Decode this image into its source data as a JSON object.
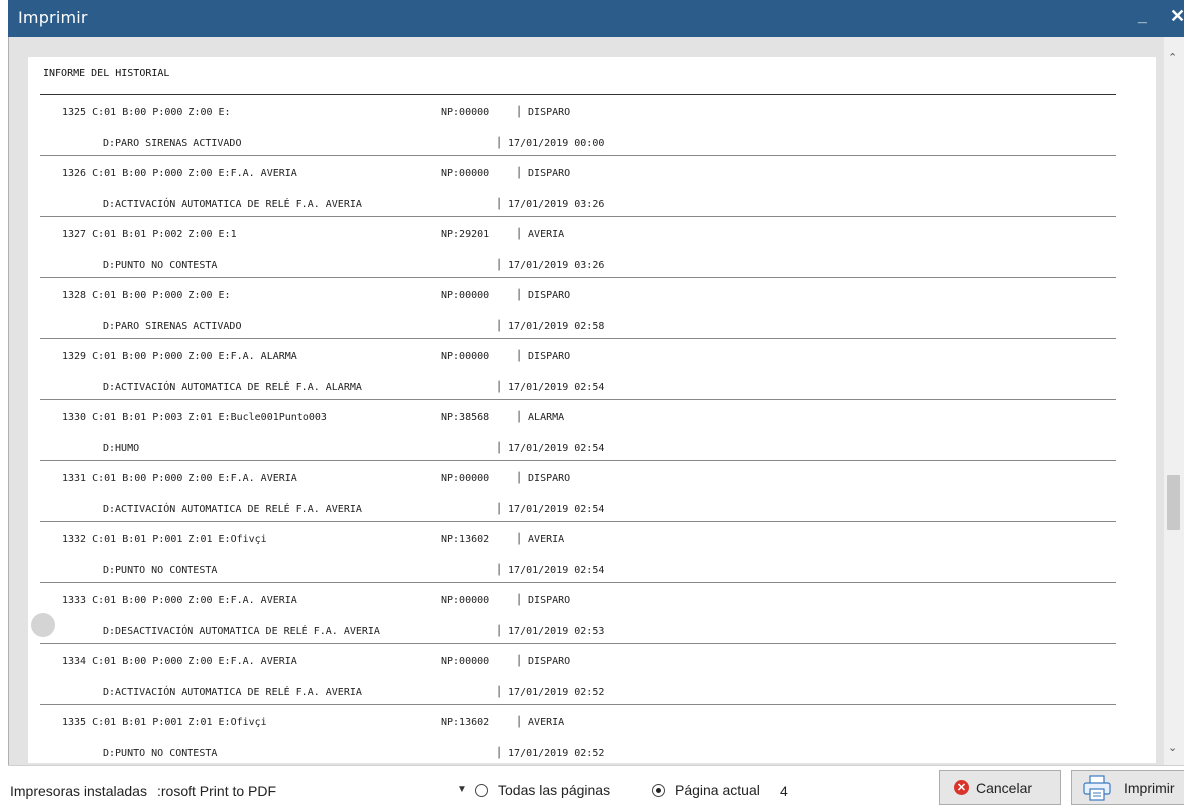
{
  "window": {
    "title": "Imprimir",
    "minimize_label": "_",
    "close_label": "✕"
  },
  "report": {
    "heading": "INFORME DEL HISTORIAL",
    "records": [
      {
        "id": "1325 C:01 B:00 P:000 Z:00 E:",
        "np": "NP:00000",
        "type": "│ DISPARO",
        "desc": "D:PARO SIRENAS ACTIVADO",
        "date": "│ 17/01/2019 00:00"
      },
      {
        "id": "1326 C:01 B:00 P:000 Z:00 E:F.A. AVERIA",
        "np": "NP:00000",
        "type": "│ DISPARO",
        "desc": "D:ACTIVACIÓN AUTOMATICA DE RELÉ F.A. AVERIA",
        "date": "│ 17/01/2019 03:26"
      },
      {
        "id": "1327 C:01 B:01 P:002 Z:00 E:1",
        "np": "NP:29201",
        "type": "│ AVERIA",
        "desc": "D:PUNTO NO CONTESTA",
        "date": "│ 17/01/2019 03:26"
      },
      {
        "id": "1328 C:01 B:00 P:000 Z:00 E:",
        "np": "NP:00000",
        "type": "│ DISPARO",
        "desc": "D:PARO SIRENAS ACTIVADO",
        "date": "│ 17/01/2019 02:58"
      },
      {
        "id": "1329 C:01 B:00 P:000 Z:00 E:F.A. ALARMA",
        "np": "NP:00000",
        "type": "│ DISPARO",
        "desc": "D:ACTIVACIÓN AUTOMATICA DE RELÉ F.A. ALARMA",
        "date": "│ 17/01/2019 02:54"
      },
      {
        "id": "1330 C:01 B:01 P:003 Z:01 E:Bucle001Punto003",
        "np": "NP:38568",
        "type": "│ ALARMA",
        "desc": "D:HUMO",
        "date": "│ 17/01/2019 02:54"
      },
      {
        "id": "1331 C:01 B:00 P:000 Z:00 E:F.A. AVERIA",
        "np": "NP:00000",
        "type": "│ DISPARO",
        "desc": "D:ACTIVACIÓN AUTOMATICA DE RELÉ F.A. AVERIA",
        "date": "│ 17/01/2019 02:54"
      },
      {
        "id": "1332 C:01 B:01 P:001 Z:01 E:Ofivçi",
        "np": "NP:13602",
        "type": "│ AVERIA",
        "desc": "D:PUNTO NO CONTESTA",
        "date": "│ 17/01/2019 02:54"
      },
      {
        "id": "1333 C:01 B:00 P:000 Z:00 E:F.A. AVERIA",
        "np": "NP:00000",
        "type": "│ DISPARO",
        "desc": "D:DESACTIVACIÓN AUTOMATICA DE RELÉ F.A. AVERIA",
        "date": "│ 17/01/2019 02:53"
      },
      {
        "id": "1334 C:01 B:00 P:000 Z:00 E:F.A. AVERIA",
        "np": "NP:00000",
        "type": "│ DISPARO",
        "desc": "D:ACTIVACIÓN AUTOMATICA DE RELÉ F.A. AVERIA",
        "date": "│ 17/01/2019 02:52"
      },
      {
        "id": "1335 C:01 B:01 P:001 Z:01 E:Ofivçi",
        "np": "NP:13602",
        "type": "│ AVERIA",
        "desc": "D:PUNTO NO CONTESTA",
        "date": "│ 17/01/2019 02:52"
      }
    ]
  },
  "footer": {
    "printers_label": "Impresoras instaladas",
    "printer_value": ":rosoft Print to PDF",
    "all_pages_label": "Todas las páginas",
    "current_page_label": "Página actual",
    "current_page_number": "4",
    "cancel_label": "Cancelar",
    "print_label": "Imprimir",
    "selected_range": "current_page"
  },
  "colors": {
    "titlebar": "#2b5c8a",
    "cancel_icon": "#d9342b"
  }
}
